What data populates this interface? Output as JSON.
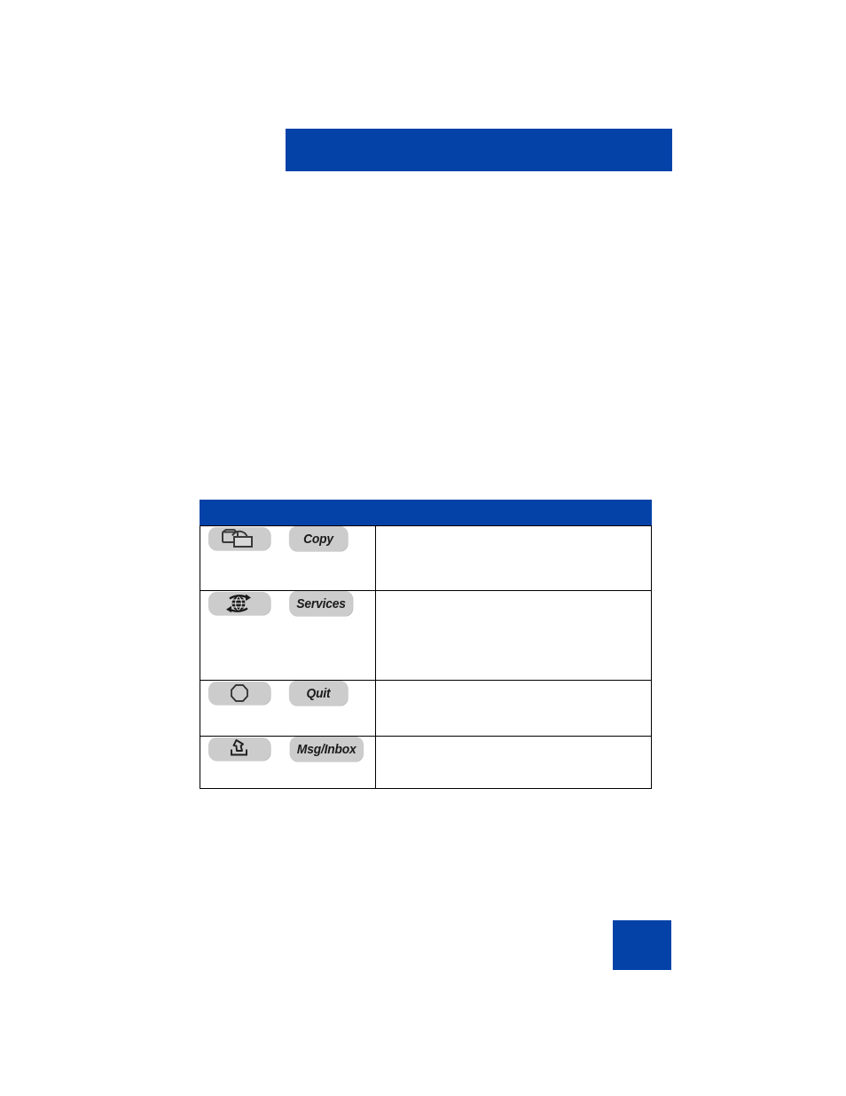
{
  "page": {
    "title_banner": {
      "text": "",
      "color": "#0442a8"
    },
    "body_copy": {
      "paragraphs": []
    },
    "page_number_block": {
      "number": "",
      "color": "#0442a8"
    }
  },
  "feature_table": {
    "header": {
      "key_column": "",
      "description_column": "",
      "background": "#0442a8"
    },
    "rows": [
      {
        "icon_name": "copy-keys-icon",
        "icon_label": "",
        "key_label": "Copy",
        "description": ""
      },
      {
        "icon_name": "globe-arrows-services-icon",
        "icon_label": "",
        "key_label": "Services",
        "description": ""
      },
      {
        "icon_name": "octagon-quit-icon",
        "icon_label": "",
        "key_label": "Quit",
        "description": ""
      },
      {
        "icon_name": "message-inbox-tray-icon",
        "icon_label": "",
        "key_label": "Msg/Inbox",
        "description": ""
      }
    ]
  },
  "colors": {
    "brand_blue": "#0442a8",
    "key_button_gray": "#cccccc",
    "table_border": "#000000",
    "text": "#000000"
  }
}
